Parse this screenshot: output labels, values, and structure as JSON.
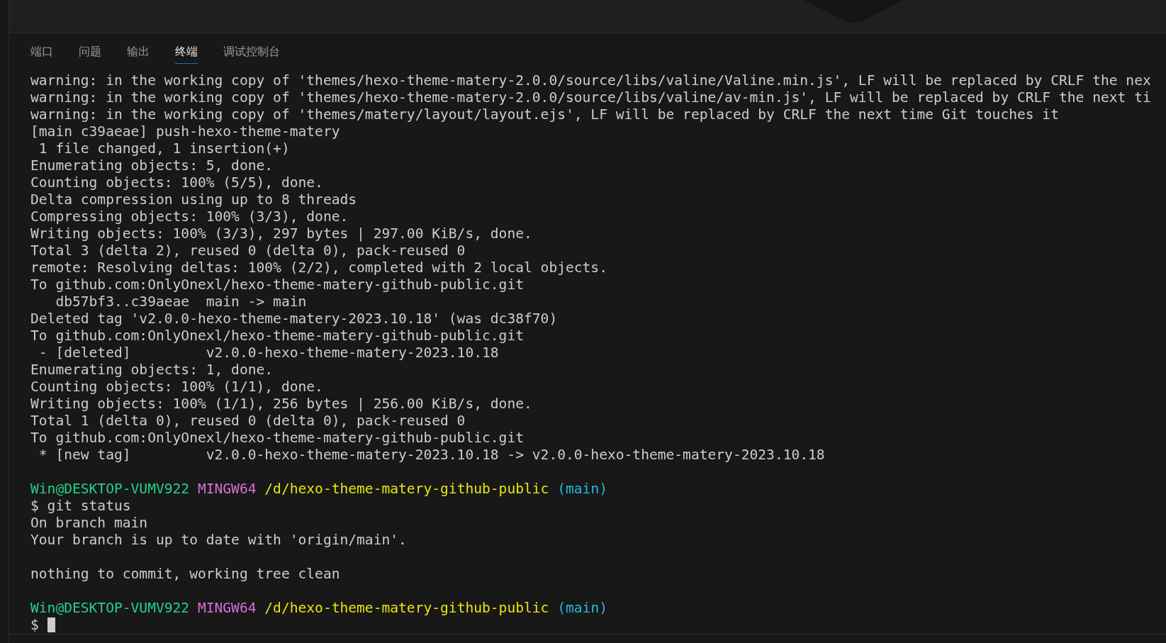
{
  "tabs": [
    {
      "label": "端口",
      "selected": false
    },
    {
      "label": "问题",
      "selected": false
    },
    {
      "label": "输出",
      "selected": false
    },
    {
      "label": "终端",
      "selected": true
    },
    {
      "label": "调试控制台",
      "selected": false
    }
  ],
  "terminal": {
    "lines": [
      {
        "kind": "text",
        "text": "warning: in the working copy of 'themes/hexo-theme-matery-2.0.0/source/libs/valine/Valine.min.js', LF will be replaced by CRLF the nex"
      },
      {
        "kind": "text",
        "text": "warning: in the working copy of 'themes/hexo-theme-matery-2.0.0/source/libs/valine/av-min.js', LF will be replaced by CRLF the next ti"
      },
      {
        "kind": "text",
        "text": "warning: in the working copy of 'themes/matery/layout/layout.ejs', LF will be replaced by CRLF the next time Git touches it"
      },
      {
        "kind": "text",
        "text": "[main c39aeae] push-hexo-theme-matery"
      },
      {
        "kind": "text",
        "text": " 1 file changed, 1 insertion(+)"
      },
      {
        "kind": "text",
        "text": "Enumerating objects: 5, done."
      },
      {
        "kind": "text",
        "text": "Counting objects: 100% (5/5), done."
      },
      {
        "kind": "text",
        "text": "Delta compression using up to 8 threads"
      },
      {
        "kind": "text",
        "text": "Compressing objects: 100% (3/3), done."
      },
      {
        "kind": "text",
        "text": "Writing objects: 100% (3/3), 297 bytes | 297.00 KiB/s, done."
      },
      {
        "kind": "text",
        "text": "Total 3 (delta 2), reused 0 (delta 0), pack-reused 0"
      },
      {
        "kind": "text",
        "text": "remote: Resolving deltas: 100% (2/2), completed with 2 local objects."
      },
      {
        "kind": "text",
        "text": "To github.com:OnlyOnexl/hexo-theme-matery-github-public.git"
      },
      {
        "kind": "text",
        "text": "   db57bf3..c39aeae  main -> main"
      },
      {
        "kind": "text",
        "text": "Deleted tag 'v2.0.0-hexo-theme-matery-2023.10.18' (was dc38f70)"
      },
      {
        "kind": "text",
        "text": "To github.com:OnlyOnexl/hexo-theme-matery-github-public.git"
      },
      {
        "kind": "text",
        "text": " - [deleted]         v2.0.0-hexo-theme-matery-2023.10.18"
      },
      {
        "kind": "text",
        "text": "Enumerating objects: 1, done."
      },
      {
        "kind": "text",
        "text": "Counting objects: 100% (1/1), done."
      },
      {
        "kind": "text",
        "text": "Writing objects: 100% (1/1), 256 bytes | 256.00 KiB/s, done."
      },
      {
        "kind": "text",
        "text": "Total 1 (delta 0), reused 0 (delta 0), pack-reused 0"
      },
      {
        "kind": "text",
        "text": "To github.com:OnlyOnexl/hexo-theme-matery-github-public.git"
      },
      {
        "kind": "text",
        "text": " * [new tag]         v2.0.0-hexo-theme-matery-2023.10.18 -> v2.0.0-hexo-theme-matery-2023.10.18"
      },
      {
        "kind": "blank"
      },
      {
        "kind": "prompt",
        "user": "Win@DESKTOP-VUMV922",
        "shell": "MINGW64",
        "path": "/d/hexo-theme-matery-github-public",
        "branch": "(main)"
      },
      {
        "kind": "text",
        "text": "$ git status"
      },
      {
        "kind": "text",
        "text": "On branch main"
      },
      {
        "kind": "text",
        "text": "Your branch is up to date with 'origin/main'."
      },
      {
        "kind": "blank"
      },
      {
        "kind": "text",
        "text": "nothing to commit, working tree clean"
      },
      {
        "kind": "blank"
      },
      {
        "kind": "prompt",
        "user": "Win@DESKTOP-VUMV922",
        "shell": "MINGW64",
        "path": "/d/hexo-theme-matery-github-public",
        "branch": "(main)"
      },
      {
        "kind": "input",
        "text": "$",
        "cursor": true
      }
    ]
  }
}
